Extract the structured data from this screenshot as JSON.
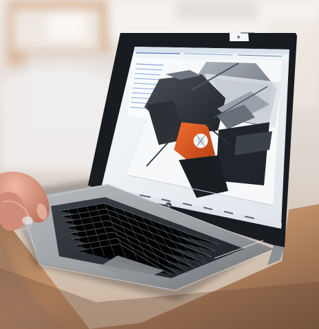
{
  "photo": {
    "subject": "laptop-cad-screen",
    "colors": {
      "background": "#e8e3dc",
      "laptop_body": "#9da0a4",
      "screen": "#eef2f6",
      "toolbar": "#dfe6ee",
      "part_orange": "#d9531e",
      "machine_gray": "#6f7680",
      "machine_dark": "#2d3138",
      "keyboard_dark": "#2b2f35",
      "table_wood": "#b88a63",
      "skin": "#d79d88"
    }
  }
}
